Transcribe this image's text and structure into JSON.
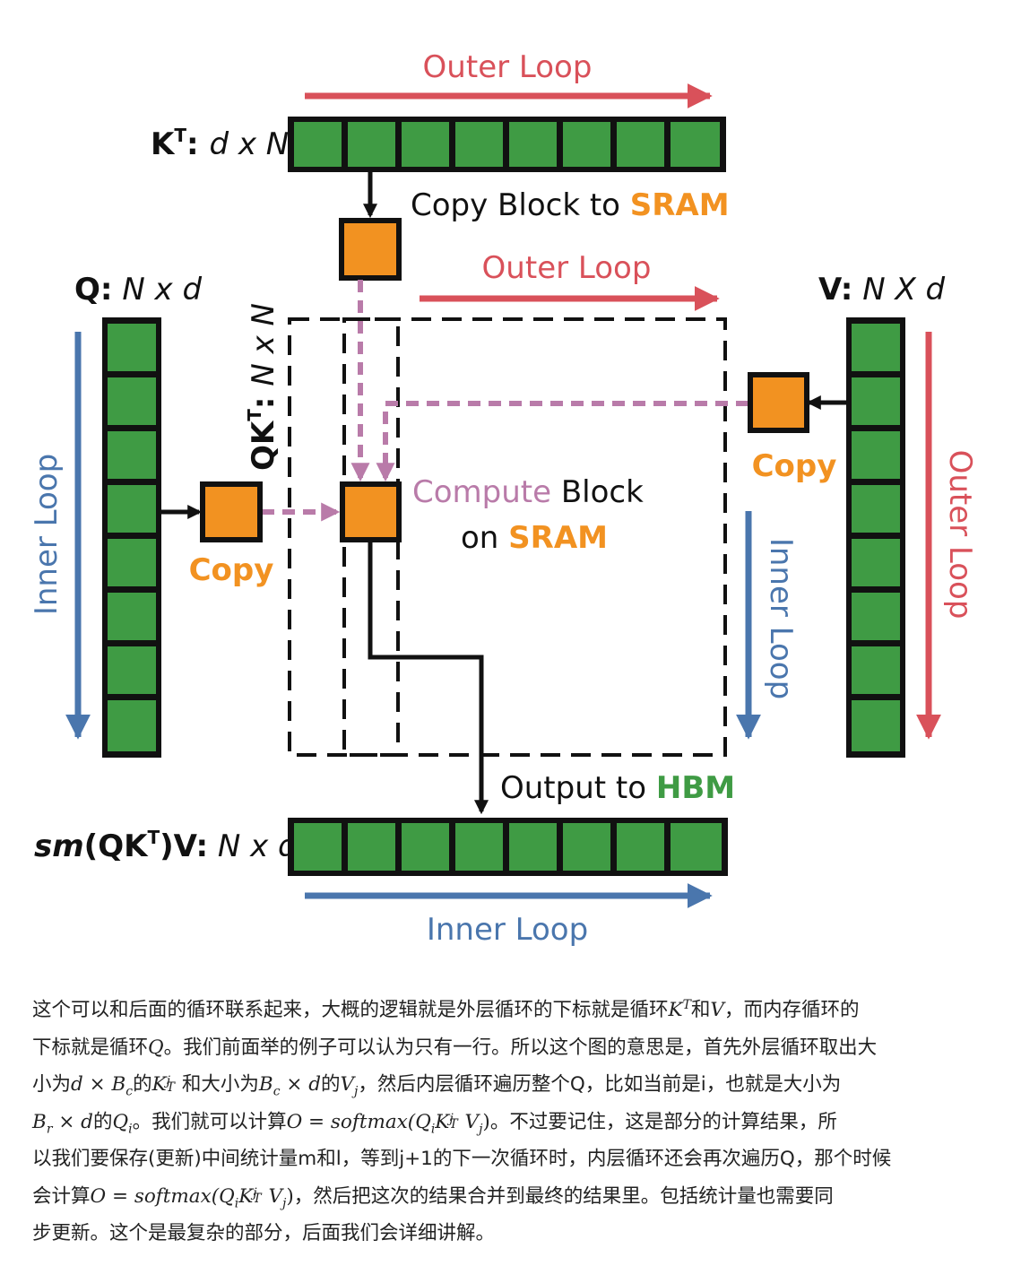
{
  "colors": {
    "outer_loop": "#d9515a",
    "inner_loop": "#4a76ad",
    "block_fill": "#3f9b44",
    "sram_block": "#f29221",
    "compute_text": "#b97ba9",
    "sram_text": "#f29221",
    "hbm_text": "#3f9b44",
    "dashed_arrow": "#b97ba9"
  },
  "diagram": {
    "top_outer_loop": "Outer Loop",
    "mid_outer_loop": "Outer Loop",
    "right_outer_loop": "Outer Loop",
    "left_inner_loop": "Inner Loop",
    "right_inner_loop": "Inner Loop",
    "bottom_inner_loop": "Inner Loop",
    "kt_label": {
      "name": "K",
      "sup": "T",
      "dims": "d x N"
    },
    "q_label": {
      "name": "Q:",
      "dims": "N x d"
    },
    "v_label": {
      "name": "V:",
      "dims": "N X d"
    },
    "qkt_label": {
      "name": "QK",
      "sup": "T",
      "dims": "N x N"
    },
    "out_label": {
      "prefix": "sm",
      "mid": "(QK",
      "sup": "T",
      "suffix": ")V:",
      "dims": "N x d"
    },
    "copy_block_text": "Copy Block to ",
    "copy_block_sram": "SRAM",
    "copy_left": "Copy",
    "copy_right": "Copy",
    "compute_word": "Compute",
    "compute_block": " Block",
    "on_word": "on ",
    "compute_sram": "SRAM",
    "output_text": "Output to ",
    "output_hbm": "HBM"
  },
  "paragraph": {
    "l1_a": "这个可以和后面的循环联系起来，大概的逻辑就是外层循环的下标就是循环",
    "l1_K": "K",
    "l1_T": "T",
    "l1_b": "和",
    "l1_V": "V",
    "l1_c": "，而内存循环的",
    "l2_a": "下标就是循环",
    "l2_Q": "Q",
    "l2_b": "。我们前面举的例子可以认为只有一行。所以这个图的意思是，首先外层循环取出大",
    "l3_a": "小为",
    "l3_d": "d × B",
    "l3_c_sub": "c",
    "l3_b": "的",
    "l3_K": "K",
    "l3_KT": "T",
    "l3_Kj": "j",
    "l3_c": "和大小为",
    "l3_B": "B",
    "l3_Bc": "c",
    "l3_xd": " × d",
    "l3_e": "的",
    "l3_V": "V",
    "l3_Vj": "j",
    "l3_f": "，然后内层循环遍历整个Q，比如当前是i，也就是大小为",
    "l4_B": "B",
    "l4_r": "r",
    "l4_xd": " × d",
    "l4_a": "的",
    "l4_Q": "Q",
    "l4_i": "i",
    "l4_b": "。我们就可以计算",
    "l4_formula": "O = softmax(Q",
    "l4_fi": "i",
    "l4_fK": "K",
    "l4_fT": "T",
    "l4_fj": "j",
    "l4_fV": "V",
    "l4_fVj": "j",
    "l4_close": ")",
    "l4_c": "。不过要记住，这是部分的计算结果，所",
    "l5": "以我们要保存(更新)中间统计量m和l，等到j+1的下一次循环时，内层循环还会再次遍历Q，那个时候",
    "l6_a": "会计算",
    "l6_formula": "O = softmax(Q",
    "l6_fi": "i",
    "l6_fK": "K",
    "l6_fT": "T",
    "l6_fj": "j",
    "l6_fV": "V",
    "l6_fVj": "j",
    "l6_close": ")",
    "l6_b": "，然后把这次的结果合并到最终的结果里。包括统计量也需要同",
    "l7": "步更新。这个是最复杂的部分，后面我们会详细讲解。"
  }
}
